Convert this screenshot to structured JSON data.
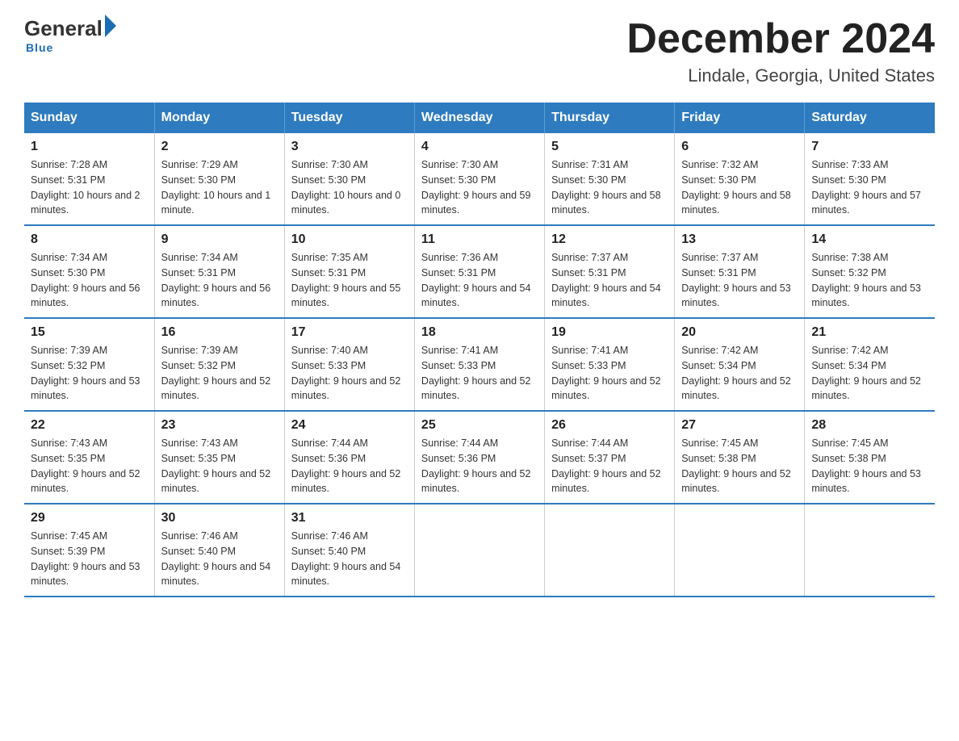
{
  "logo": {
    "general": "General",
    "arrow": "▶",
    "blue": "Blue"
  },
  "header": {
    "title": "December 2024",
    "location": "Lindale, Georgia, United States"
  },
  "weekdays": [
    "Sunday",
    "Monday",
    "Tuesday",
    "Wednesday",
    "Thursday",
    "Friday",
    "Saturday"
  ],
  "weeks": [
    [
      {
        "day": "1",
        "sunrise": "7:28 AM",
        "sunset": "5:31 PM",
        "daylight": "10 hours and 2 minutes."
      },
      {
        "day": "2",
        "sunrise": "7:29 AM",
        "sunset": "5:30 PM",
        "daylight": "10 hours and 1 minute."
      },
      {
        "day": "3",
        "sunrise": "7:30 AM",
        "sunset": "5:30 PM",
        "daylight": "10 hours and 0 minutes."
      },
      {
        "day": "4",
        "sunrise": "7:30 AM",
        "sunset": "5:30 PM",
        "daylight": "9 hours and 59 minutes."
      },
      {
        "day": "5",
        "sunrise": "7:31 AM",
        "sunset": "5:30 PM",
        "daylight": "9 hours and 58 minutes."
      },
      {
        "day": "6",
        "sunrise": "7:32 AM",
        "sunset": "5:30 PM",
        "daylight": "9 hours and 58 minutes."
      },
      {
        "day": "7",
        "sunrise": "7:33 AM",
        "sunset": "5:30 PM",
        "daylight": "9 hours and 57 minutes."
      }
    ],
    [
      {
        "day": "8",
        "sunrise": "7:34 AM",
        "sunset": "5:30 PM",
        "daylight": "9 hours and 56 minutes."
      },
      {
        "day": "9",
        "sunrise": "7:34 AM",
        "sunset": "5:31 PM",
        "daylight": "9 hours and 56 minutes."
      },
      {
        "day": "10",
        "sunrise": "7:35 AM",
        "sunset": "5:31 PM",
        "daylight": "9 hours and 55 minutes."
      },
      {
        "day": "11",
        "sunrise": "7:36 AM",
        "sunset": "5:31 PM",
        "daylight": "9 hours and 54 minutes."
      },
      {
        "day": "12",
        "sunrise": "7:37 AM",
        "sunset": "5:31 PM",
        "daylight": "9 hours and 54 minutes."
      },
      {
        "day": "13",
        "sunrise": "7:37 AM",
        "sunset": "5:31 PM",
        "daylight": "9 hours and 53 minutes."
      },
      {
        "day": "14",
        "sunrise": "7:38 AM",
        "sunset": "5:32 PM",
        "daylight": "9 hours and 53 minutes."
      }
    ],
    [
      {
        "day": "15",
        "sunrise": "7:39 AM",
        "sunset": "5:32 PM",
        "daylight": "9 hours and 53 minutes."
      },
      {
        "day": "16",
        "sunrise": "7:39 AM",
        "sunset": "5:32 PM",
        "daylight": "9 hours and 52 minutes."
      },
      {
        "day": "17",
        "sunrise": "7:40 AM",
        "sunset": "5:33 PM",
        "daylight": "9 hours and 52 minutes."
      },
      {
        "day": "18",
        "sunrise": "7:41 AM",
        "sunset": "5:33 PM",
        "daylight": "9 hours and 52 minutes."
      },
      {
        "day": "19",
        "sunrise": "7:41 AM",
        "sunset": "5:33 PM",
        "daylight": "9 hours and 52 minutes."
      },
      {
        "day": "20",
        "sunrise": "7:42 AM",
        "sunset": "5:34 PM",
        "daylight": "9 hours and 52 minutes."
      },
      {
        "day": "21",
        "sunrise": "7:42 AM",
        "sunset": "5:34 PM",
        "daylight": "9 hours and 52 minutes."
      }
    ],
    [
      {
        "day": "22",
        "sunrise": "7:43 AM",
        "sunset": "5:35 PM",
        "daylight": "9 hours and 52 minutes."
      },
      {
        "day": "23",
        "sunrise": "7:43 AM",
        "sunset": "5:35 PM",
        "daylight": "9 hours and 52 minutes."
      },
      {
        "day": "24",
        "sunrise": "7:44 AM",
        "sunset": "5:36 PM",
        "daylight": "9 hours and 52 minutes."
      },
      {
        "day": "25",
        "sunrise": "7:44 AM",
        "sunset": "5:36 PM",
        "daylight": "9 hours and 52 minutes."
      },
      {
        "day": "26",
        "sunrise": "7:44 AM",
        "sunset": "5:37 PM",
        "daylight": "9 hours and 52 minutes."
      },
      {
        "day": "27",
        "sunrise": "7:45 AM",
        "sunset": "5:38 PM",
        "daylight": "9 hours and 52 minutes."
      },
      {
        "day": "28",
        "sunrise": "7:45 AM",
        "sunset": "5:38 PM",
        "daylight": "9 hours and 53 minutes."
      }
    ],
    [
      {
        "day": "29",
        "sunrise": "7:45 AM",
        "sunset": "5:39 PM",
        "daylight": "9 hours and 53 minutes."
      },
      {
        "day": "30",
        "sunrise": "7:46 AM",
        "sunset": "5:40 PM",
        "daylight": "9 hours and 54 minutes."
      },
      {
        "day": "31",
        "sunrise": "7:46 AM",
        "sunset": "5:40 PM",
        "daylight": "9 hours and 54 minutes."
      },
      null,
      null,
      null,
      null
    ]
  ]
}
